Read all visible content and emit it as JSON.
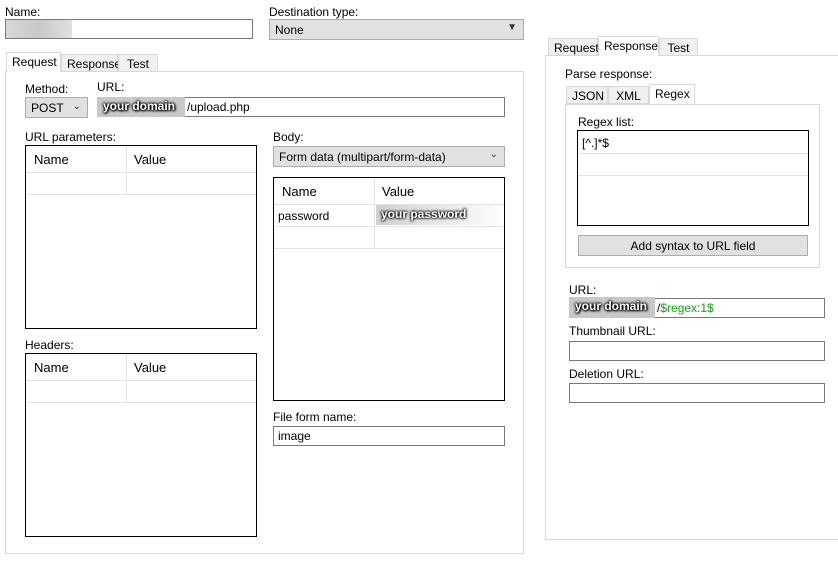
{
  "name": {
    "label": "Name:",
    "value": ""
  },
  "destination": {
    "label": "Destination type:",
    "value": "None"
  },
  "left_tabs": [
    {
      "label": "Request"
    },
    {
      "label": "Response"
    },
    {
      "label": "Test"
    }
  ],
  "request": {
    "method_label": "Method:",
    "method_value": "POST",
    "url_label": "URL:",
    "url_redacted": "your domain",
    "url_suffix": "/upload.php",
    "url_params_label": "URL parameters:",
    "url_params_columns": [
      "Name",
      "Value"
    ],
    "headers_label": "Headers:",
    "headers_columns": [
      "Name",
      "Value"
    ],
    "body_label": "Body:",
    "body_value": "Form data (multipart/form-data)",
    "body_columns": [
      "Name",
      "Value"
    ],
    "body_rows": [
      {
        "name": "password",
        "value": "your password"
      }
    ],
    "file_form_label": "File form name:",
    "file_form_value": "image"
  },
  "right_tabs": [
    {
      "label": "Request"
    },
    {
      "label": "Response"
    },
    {
      "label": "Test"
    }
  ],
  "response": {
    "parse_label": "Parse response:",
    "sub_tabs": [
      {
        "label": "JSON"
      },
      {
        "label": "XML"
      },
      {
        "label": "Regex"
      }
    ],
    "regex_list_label": "Regex list:",
    "regex_items": [
      "[^.]*$"
    ],
    "add_syntax_button": "Add syntax to URL field",
    "url_label": "URL:",
    "url_redacted": "your domain",
    "url_suffix_slash": "/",
    "url_suffix_syntax": "$regex:1$",
    "syntax_color": "#1a9e1a",
    "thumbnail_label": "Thumbnail URL:",
    "thumbnail_value": "",
    "deletion_label": "Deletion URL:",
    "deletion_value": ""
  }
}
